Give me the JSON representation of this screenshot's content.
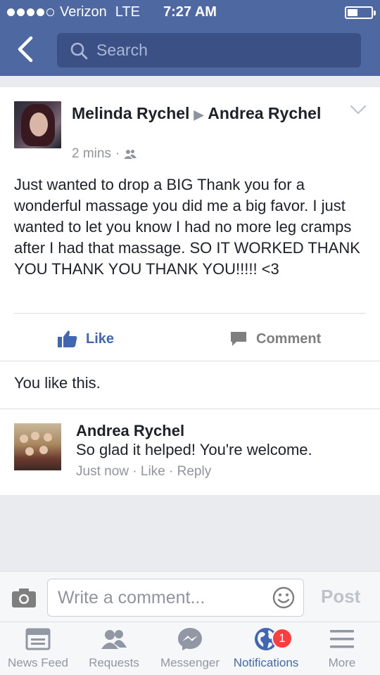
{
  "status_bar": {
    "carrier": "Verizon",
    "network": "LTE",
    "time": "7:27 AM"
  },
  "header": {
    "search_placeholder": "Search"
  },
  "post": {
    "author": "Melinda Rychel",
    "recipient": "Andrea Rychel",
    "time": "2 mins",
    "audience_icon": "friends-icon",
    "text": "Just wanted to drop a BIG Thank you for a wonderful massage you did me a big favor. I just wanted to let you know I had no more leg cramps after I had that massage. SO IT WORKED THANK YOU THANK YOU THANK YOU!!!!! <3",
    "like_label": "Like",
    "comment_label": "Comment",
    "likes_summary": "You like this."
  },
  "comment": {
    "author": "Andrea Rychel",
    "text": "So glad it helped! You're welcome.",
    "time": "Just now",
    "like_label": "Like",
    "reply_label": "Reply"
  },
  "composer": {
    "placeholder": "Write a comment...",
    "post_label": "Post"
  },
  "tabs": [
    {
      "label": "News Feed",
      "icon": "news-feed-icon"
    },
    {
      "label": "Requests",
      "icon": "requests-icon"
    },
    {
      "label": "Messenger",
      "icon": "messenger-icon"
    },
    {
      "label": "Notifications",
      "icon": "globe-icon",
      "badge": "1",
      "active": true
    },
    {
      "label": "More",
      "icon": "menu-icon"
    }
  ],
  "colors": {
    "brand": "#4e69a2",
    "link": "#4267b2",
    "badge": "#fa3e3e"
  }
}
